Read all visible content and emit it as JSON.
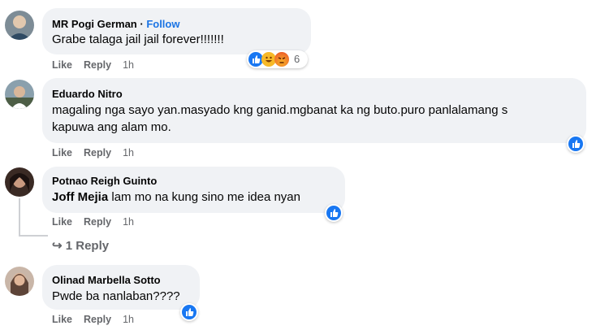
{
  "comments": [
    {
      "author": "MR Pogi German",
      "follow": "Follow",
      "text": "Grabe talaga jail jail forever!!!!!!!",
      "like": "Like",
      "reply": "Reply",
      "time": "1h",
      "reaction_count": "6",
      "reactions": [
        "like-icon",
        "haha-icon",
        "angry-icon"
      ]
    },
    {
      "author": "Eduardo Nitro",
      "text_line1": "magaling nga sayo yan.masyado kng ganid.mgbanat ka ng buto.puro panlalamang s",
      "text_line2": "kapuwa ang alam mo.",
      "like": "Like",
      "reply": "Reply",
      "time": "1h",
      "reactions": [
        "like-icon"
      ]
    },
    {
      "author": "Potnao Reigh Guinto",
      "mention": "Joff Mejia",
      "text": "lam mo na kung sino me idea nyan",
      "like": "Like",
      "reply": "Reply",
      "time": "1h",
      "reactions": [
        "like-icon"
      ],
      "replies_label": "1 Reply"
    },
    {
      "author": "Olinad Marbella Sotto",
      "text": "Pwde ba nanlaban????",
      "like": "Like",
      "reply": "Reply",
      "time": "1h",
      "reactions": [
        "like-icon"
      ]
    }
  ],
  "colors": {
    "bubble": "#f0f2f5",
    "muted": "#65676b",
    "follow": "#1b74e4",
    "like_blue": "#1877f2"
  }
}
